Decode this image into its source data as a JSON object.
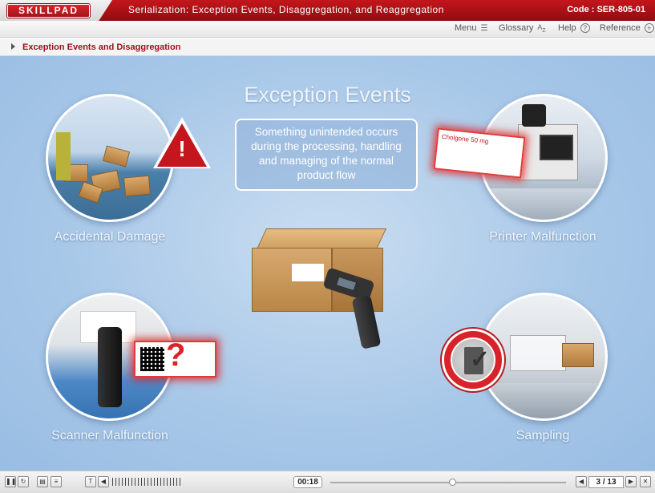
{
  "header": {
    "logo_text": "SKILLPAD",
    "course_title": "Serialization: Exception Events, Disaggregation, and Reaggregation",
    "code": "Code : SER-805-01"
  },
  "nav": {
    "menu": "Menu",
    "glossary": "Glossary",
    "help": "Help",
    "reference": "Reference",
    "icons": [
      "menu-icon",
      "glossary-az-icon",
      "help-icon",
      "reference-plus-icon"
    ]
  },
  "breadcrumb": {
    "text": "Exception Events and Disaggregation"
  },
  "stage": {
    "title": "Exception Events",
    "description": "Something unintended occurs during the processing, handling and managing of the normal product flow",
    "items": [
      {
        "label": "Accidental Damage"
      },
      {
        "label": "Printer Malfunction"
      },
      {
        "label": "Scanner Malfunction"
      },
      {
        "label": "Sampling"
      }
    ]
  },
  "footer": {
    "time": "00:18",
    "page_current": "3",
    "page_total": "13",
    "page_text": "3 / 13",
    "text_button": "T"
  },
  "colors": {
    "brand_red": "#c4161c",
    "stage_blue": "#a9c8e8"
  }
}
